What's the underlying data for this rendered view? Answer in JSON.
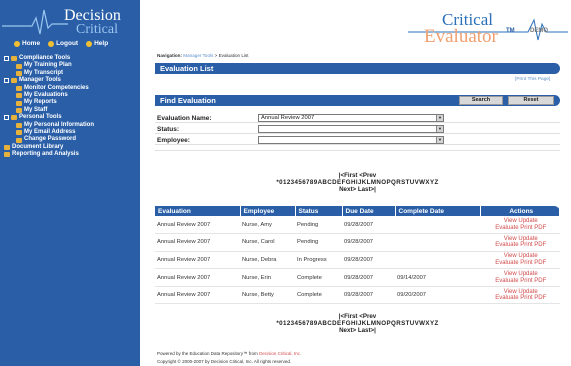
{
  "sidebar": {
    "logo_line1": "Decision",
    "logo_line2": "Critical",
    "topnav": {
      "home": "Home",
      "logout": "Logout",
      "help": "Help"
    },
    "menu": [
      {
        "kind": "section",
        "label": "Compliance Tools"
      },
      {
        "kind": "item",
        "label": "My Training Plan"
      },
      {
        "kind": "item",
        "label": "My Transcript"
      },
      {
        "kind": "section",
        "label": "Manager Tools"
      },
      {
        "kind": "item",
        "label": "Monitor Competencies"
      },
      {
        "kind": "item",
        "label": "My Evaluations"
      },
      {
        "kind": "item",
        "label": "My Reports"
      },
      {
        "kind": "item",
        "label": "My Staff"
      },
      {
        "kind": "section",
        "label": "Personal Tools"
      },
      {
        "kind": "item",
        "label": "My Personal Information"
      },
      {
        "kind": "item",
        "label": "My Email Address"
      },
      {
        "kind": "item",
        "label": "Change Password"
      },
      {
        "kind": "top",
        "label": "Document Library"
      },
      {
        "kind": "top",
        "label": "Reporting and Analysis"
      }
    ]
  },
  "brand": {
    "line1": "Critical",
    "line2": "Evaluator",
    "tm": "TM",
    "demo": "DEMO"
  },
  "breadcrumb": {
    "lead": "Navigation:",
    "link": "Manager Tools",
    "sep": ">",
    "current": "Evaluation List"
  },
  "evaluation_list": {
    "title": "Evaluation List",
    "print": "[Print This Page]"
  },
  "find": {
    "title": "Find Evaluation",
    "search_label": "Search",
    "reset_label": "Reset",
    "fields": [
      {
        "label": "Evaluation Name:",
        "value": "Annual Review 2007"
      },
      {
        "label": "Status:",
        "value": ""
      },
      {
        "label": "Employee:",
        "value": ""
      }
    ]
  },
  "pager": {
    "nav_top": "|<First <Prev",
    "letters": "*0123456789ABCDEFGHIJKLMNOPQRSTUVWXYZ",
    "nav_bottom": "Next> Last>|"
  },
  "table": {
    "headers": [
      "Evaluation",
      "Employee",
      "Status",
      "Due Date",
      "Complete Date",
      "Actions"
    ],
    "rows": [
      {
        "evaluation": "Annual Review 2007",
        "employee": "Nurse, Amy",
        "status": "Pending",
        "due": "09/28/2007",
        "complete": ""
      },
      {
        "evaluation": "Annual Review 2007",
        "employee": "Nurse, Carol",
        "status": "Pending",
        "due": "09/28/2007",
        "complete": ""
      },
      {
        "evaluation": "Annual Review 2007",
        "employee": "Nurse, Debra",
        "status": "In Progress",
        "due": "09/28/2007",
        "complete": ""
      },
      {
        "evaluation": "Annual Review 2007",
        "employee": "Nurse, Erin",
        "status": "Complete",
        "due": "09/28/2007",
        "complete": "09/14/2007"
      },
      {
        "evaluation": "Annual Review 2007",
        "employee": "Nurse, Betty",
        "status": "Complete",
        "due": "09/28/2007",
        "complete": "09/20/2007"
      }
    ],
    "actions": {
      "view": "View",
      "update": "Update",
      "evaluate": "Evaluate",
      "print": "Print",
      "pdf": "PDF"
    }
  },
  "footer": {
    "line1_pre": "Powered by the Education Data Repository™ from",
    "line1_link": "Decision Critical, Inc.",
    "line2": "Copyright © 2000-2007 by Decision Critical, Inc. All rights reserved."
  },
  "colors": {
    "sidebar": "#2a5fa8",
    "accent": "#d24b4b",
    "brand_blue": "#2a6fb8",
    "brand_orange": "#f0a070"
  }
}
